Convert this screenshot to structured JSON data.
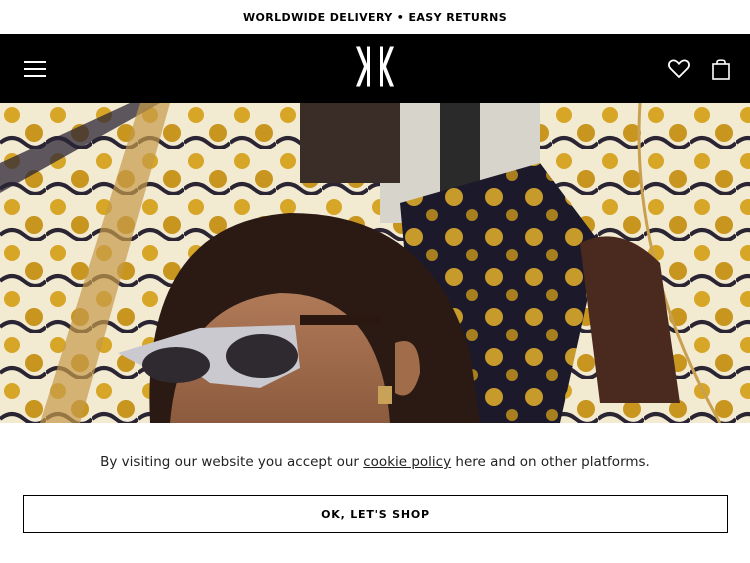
{
  "promo": {
    "text": "WORLDWIDE DELIVERY • EASY RETURNS"
  },
  "header": {
    "menu_icon": "hamburger-menu-icon",
    "logo_icon": "brand-monogram-logo",
    "wishlist_icon": "heart-icon",
    "bag_icon": "shopping-bag-icon",
    "background": "#000000",
    "foreground": "#ffffff"
  },
  "hero": {
    "image": "campaign-photo-woman-sunglasses-baroque-print"
  },
  "cookie": {
    "text_before": "By visiting our website you accept our ",
    "link_text": "cookie policy",
    "text_after": " here and on other platforms.",
    "button_label": "OK, LET'S SHOP"
  }
}
